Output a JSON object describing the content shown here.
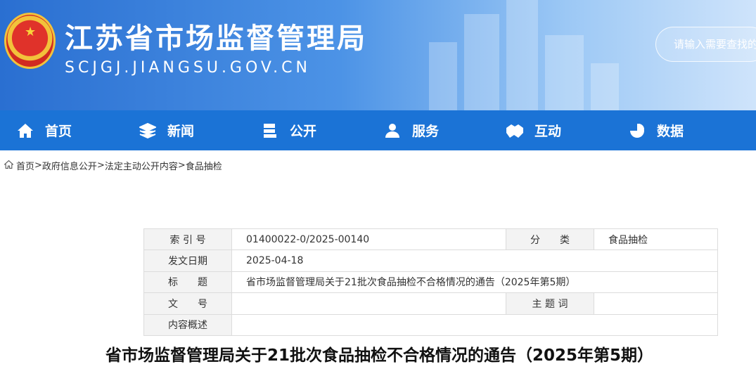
{
  "site": {
    "title": "江苏省市场监督管理局",
    "domain": "SCJGJ.JIANGSU.GOV.CN"
  },
  "search": {
    "placeholder": "请输入需要查找的"
  },
  "nav": [
    {
      "label": "首页",
      "icon": "home-icon"
    },
    {
      "label": "新闻",
      "icon": "layers-icon"
    },
    {
      "label": "公开",
      "icon": "document-stack-icon"
    },
    {
      "label": "服务",
      "icon": "user-icon"
    },
    {
      "label": "互动",
      "icon": "handshake-icon"
    },
    {
      "label": "数据",
      "icon": "pie-chart-icon"
    }
  ],
  "breadcrumb": [
    "首页",
    ">",
    "政府信息公开",
    ">",
    "法定主动公开内容",
    ">",
    "食品抽检"
  ],
  "meta": {
    "index_label": "索 引 号",
    "index_value": "01400022-0/2025-00140",
    "category_label": "分　　类",
    "category_value": "食品抽检",
    "date_label": "发文日期",
    "date_value": "2025-04-18",
    "title_label": "标　　题",
    "title_value": "省市场监督管理局关于21批次食品抽检不合格情况的通告（2025年第5期）",
    "doc_label": "文　　号",
    "doc_value": "",
    "keywords_label": "主 题 词",
    "keywords_value": "",
    "summary_label": "内容概述",
    "summary_value": ""
  },
  "article_title": "省市场监督管理局关于21批次食品抽检不合格情况的通告（2025年第5期）"
}
